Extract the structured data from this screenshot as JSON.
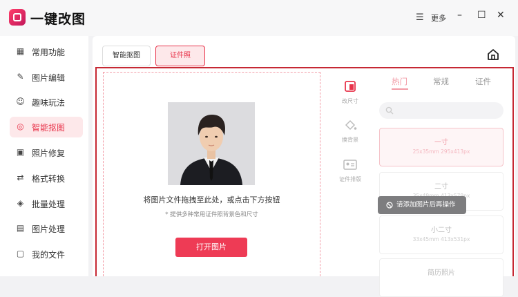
{
  "app": {
    "title": "一键改图"
  },
  "titlebar": {
    "menu_icon": "☰",
    "menu_label": "更多",
    "minimize": "–",
    "maximize": "☐",
    "close": "✕"
  },
  "sidebar": {
    "items": [
      {
        "label": "常用功能",
        "icon": "grid-icon"
      },
      {
        "label": "图片编辑",
        "icon": "edit-icon"
      },
      {
        "label": "趣味玩法",
        "icon": "person-icon"
      },
      {
        "label": "智能抠图",
        "icon": "target-icon"
      },
      {
        "label": "照片修复",
        "icon": "repair-icon"
      },
      {
        "label": "格式转换",
        "icon": "convert-icon"
      },
      {
        "label": "批量处理",
        "icon": "layers-icon"
      },
      {
        "label": "图片处理",
        "icon": "image-icon"
      },
      {
        "label": "我的文件",
        "icon": "file-icon"
      }
    ],
    "active_index": 3
  },
  "tabs": [
    {
      "label": "智能抠图",
      "active": false
    },
    {
      "label": "证件照",
      "active": true
    }
  ],
  "dropzone": {
    "main_text": "将图片文件拖拽至此处，或点击下方按钮",
    "sub_text": "* 提供多种常用证件照背景色和尺寸",
    "button": "打开图片"
  },
  "tools": [
    {
      "label": "改尺寸",
      "icon": "crop-icon"
    },
    {
      "label": "换背景",
      "icon": "fill-bucket-icon"
    },
    {
      "label": "证件排版",
      "icon": "id-card-icon"
    }
  ],
  "categories": {
    "items": [
      "热门",
      "常规",
      "证件"
    ],
    "active_index": 0
  },
  "sizes": [
    {
      "name": "一寸",
      "detail": "25x35mm   295x413px"
    },
    {
      "name": "二寸",
      "detail": "35x49mm   413x579px"
    },
    {
      "name": "小二寸",
      "detail": "33x45mm   413x531px"
    },
    {
      "name": "简历照片",
      "detail": ""
    }
  ],
  "toast": {
    "text": "请添加图片后再操作"
  },
  "colors": {
    "accent": "#e8334a",
    "frame": "#c62833",
    "toast_bg": "#7d7d7f"
  }
}
